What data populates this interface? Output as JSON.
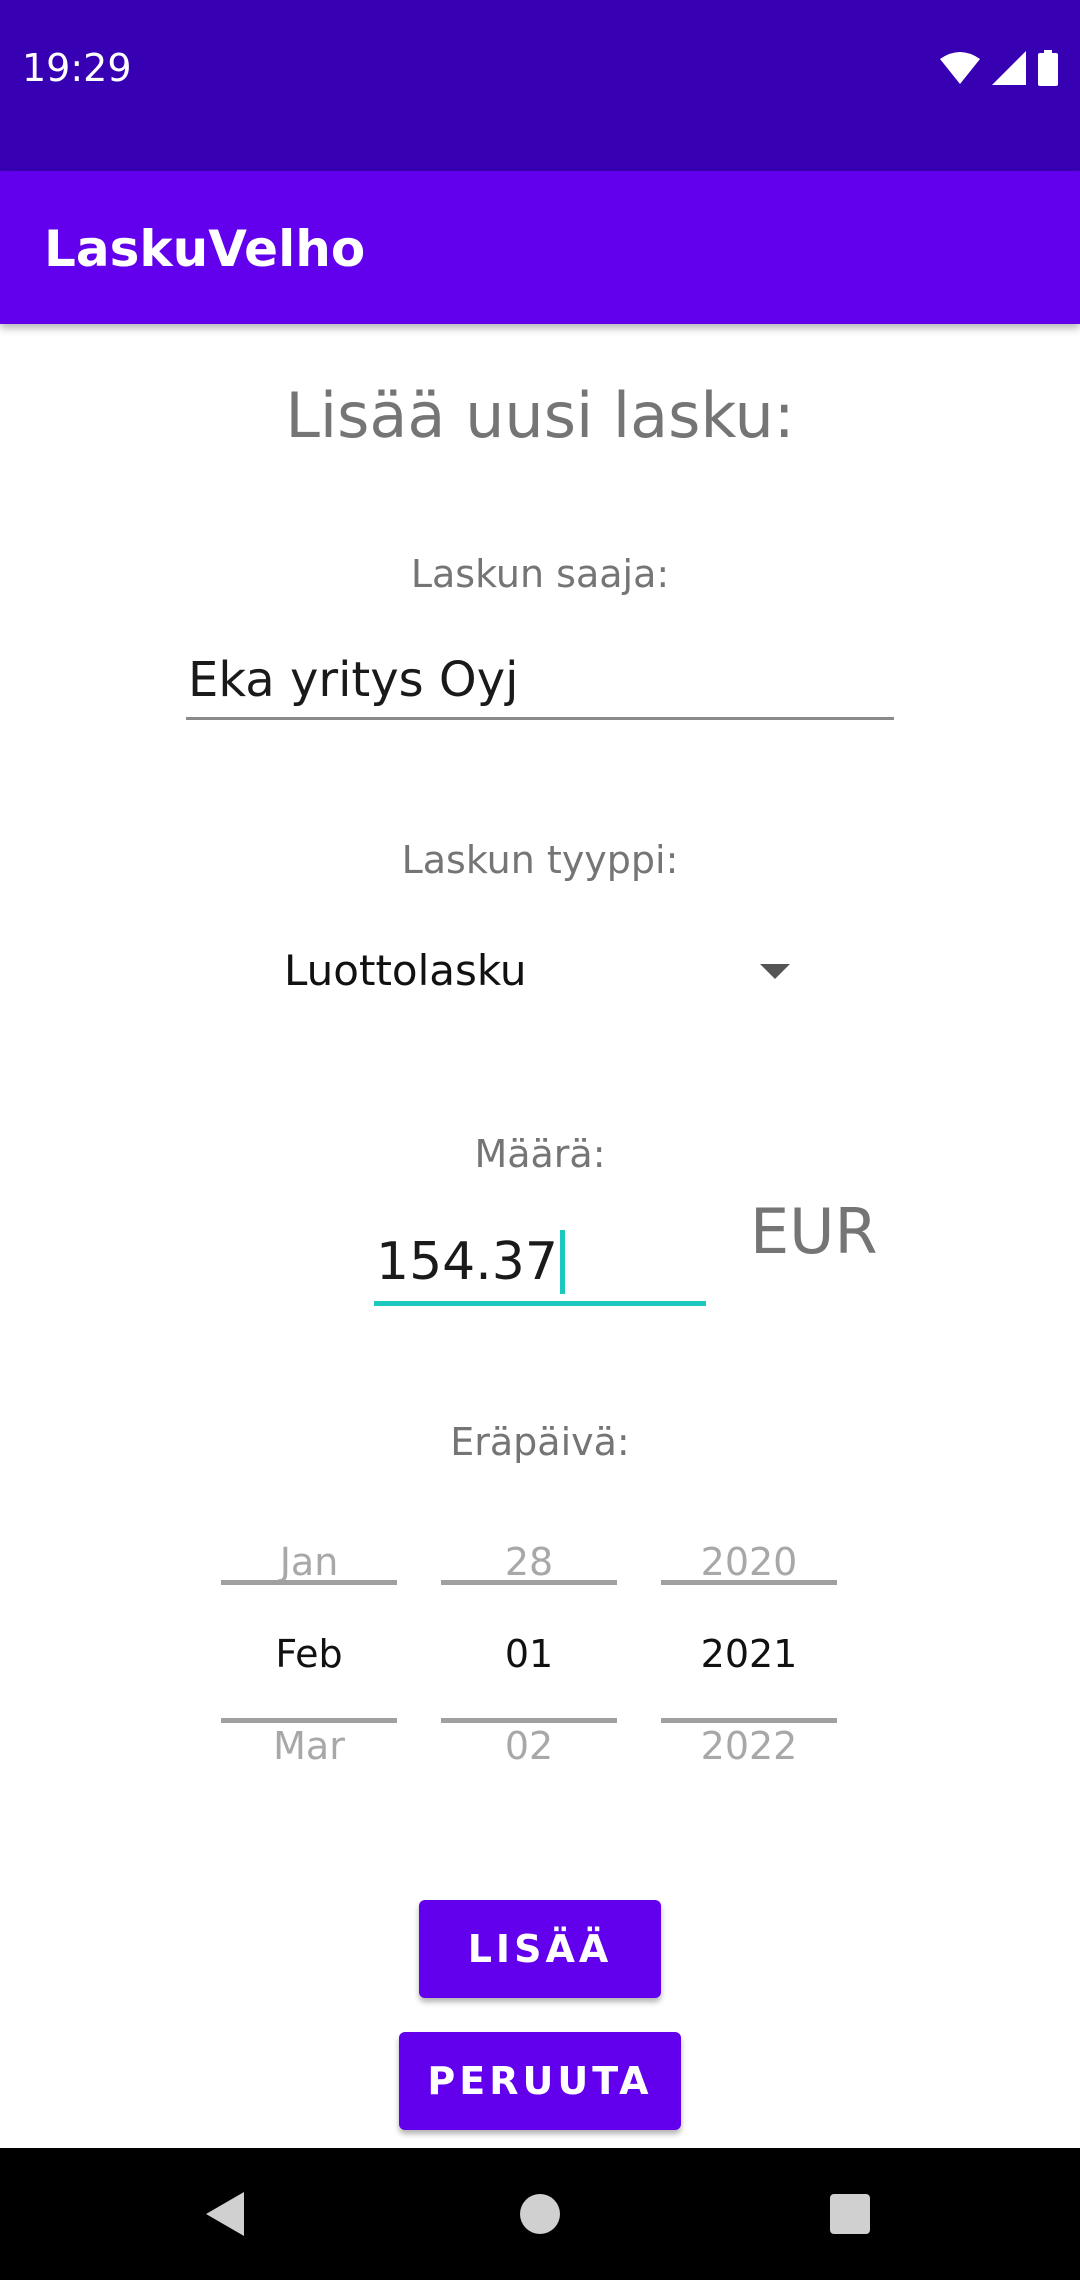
{
  "status_bar": {
    "time": "19:29",
    "icons": [
      "wifi-icon",
      "signal-icon",
      "battery-icon"
    ]
  },
  "app_bar": {
    "title": "LaskuVelho",
    "color": "#6200ee"
  },
  "form": {
    "heading": "Lisää uusi lasku:",
    "recipient_label": "Laskun saaja:",
    "recipient_value": "Eka yritys Oyj",
    "type_label": "Laskun tyyppi:",
    "type_value": "Luottolasku",
    "amount_label": "Määrä:",
    "amount_value": "154.37",
    "currency": "EUR",
    "due_label": "Eräpäivä:",
    "date_picker": {
      "month": {
        "prev": "Jan",
        "current": "Feb",
        "next": "Mar"
      },
      "day": {
        "prev": "28",
        "current": "01",
        "next": "02"
      },
      "year": {
        "prev": "2020",
        "current": "2021",
        "next": "2022"
      }
    }
  },
  "actions": {
    "add_label": "LISÄÄ",
    "cancel_label": "PERUUTA"
  },
  "colors": {
    "status_bar": "#3700b3",
    "primary": "#6200ee",
    "accent": "#1dc8bd"
  },
  "nav_bar": {
    "icons": [
      "back-icon",
      "home-icon",
      "recents-icon"
    ]
  }
}
